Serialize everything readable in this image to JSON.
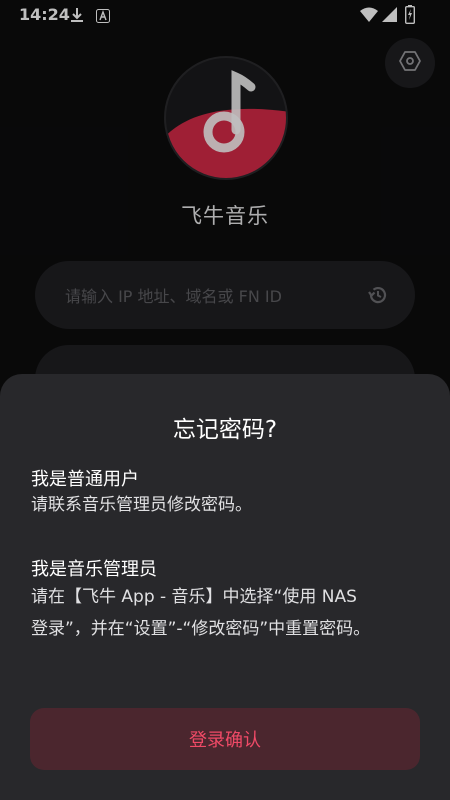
{
  "status_bar": {
    "time": "14:24"
  },
  "app": {
    "name": "飞牛音乐"
  },
  "server_input": {
    "placeholder": "请输入 IP 地址、域名或 FN ID"
  },
  "dialog": {
    "title": "忘记密码?",
    "user_heading": "我是普通用户",
    "user_text": "请联系音乐管理员修改密码。",
    "admin_heading": "我是音乐管理员",
    "admin_text_line1": "请在【飞牛 App - 音乐】中选择“使用 NAS",
    "admin_text_line2": "登录”，并在“设置”-“修改密码”中重置密码。",
    "confirm_label": "登录确认"
  },
  "colors": {
    "background": "#0c0c0d",
    "surface": "#1f1f22",
    "sheet": "#28282b",
    "accent": "#e8344f",
    "button_bg": "#4b262e"
  }
}
